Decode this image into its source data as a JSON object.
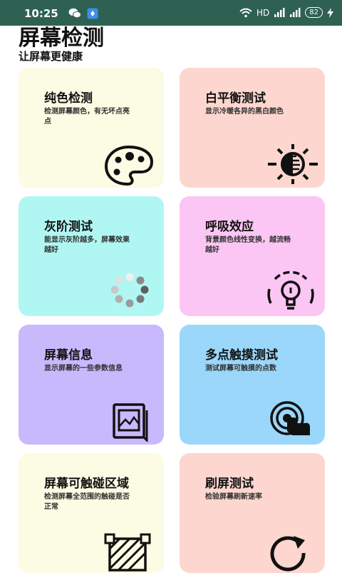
{
  "status_bar": {
    "time": "10:25",
    "network_label": "HD",
    "battery": "82"
  },
  "header": {
    "title": "屏幕检测",
    "subtitle": "让屏幕更健康"
  },
  "cards": [
    {
      "title": "纯色检测",
      "desc": "检测屏幕颜色，有无坏点亮点",
      "icon": "palette-icon",
      "bg": "#fcfbe3"
    },
    {
      "title": "白平衡测试",
      "desc": "显示冷暖各异的黑白颜色",
      "icon": "brightness-icon",
      "bg": "#fdd7cf"
    },
    {
      "title": "灰阶测试",
      "desc": "能显示灰阶越多，屏幕效果越好",
      "icon": "loading-dots-icon",
      "bg": "#b0f7f3"
    },
    {
      "title": "呼吸效应",
      "desc": "背景颜色线性变换，越流畅越好",
      "icon": "lightbulb-icon",
      "bg": "#fcc6f4"
    },
    {
      "title": "屏幕信息",
      "desc": "显示屏幕的一些参数信息",
      "icon": "picture-frame-icon",
      "bg": "#c7b9fc"
    },
    {
      "title": "多点触摸测试",
      "desc": "测试屏幕可触摸的点数",
      "icon": "touch-icon",
      "bg": "#9ad7fb"
    },
    {
      "title": "屏幕可触碰区域",
      "desc": "检测屏幕全范围的触碰是否正常",
      "icon": "hatched-area-icon",
      "bg": "#fcfbe3"
    },
    {
      "title": "刷屏测试",
      "desc": "检验屏幕刷新速率",
      "icon": "refresh-icon",
      "bg": "#fdd7cf"
    }
  ]
}
